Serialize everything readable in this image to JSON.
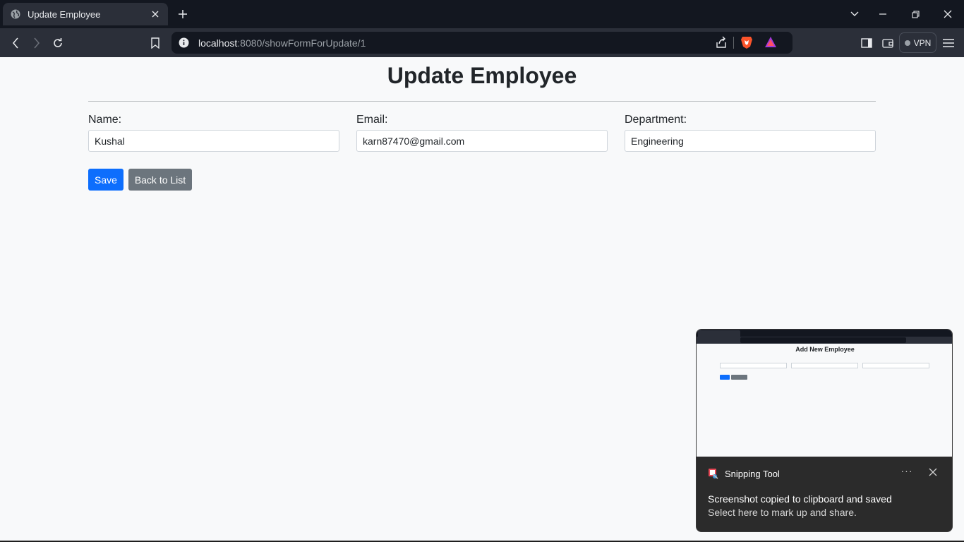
{
  "browser": {
    "tab_title": "Update Employee",
    "url_host": "localhost",
    "url_rest": ":8080/showFormForUpdate/1",
    "vpn_label": "VPN"
  },
  "page": {
    "title": "Update Employee",
    "fields": [
      {
        "label": "Name:",
        "value": "Kushal"
      },
      {
        "label": "Email:",
        "value": "karn87470@gmail.com"
      },
      {
        "label": "Department:",
        "value": "Engineering"
      }
    ],
    "save_label": "Save",
    "back_label": "Back to List"
  },
  "notification": {
    "app_name": "Snipping Tool",
    "more_label": "···",
    "title": "Screenshot copied to clipboard and saved",
    "body": "Select here to mark up and share.",
    "thumbnail_title": "Add New Employee"
  },
  "colors": {
    "primary": "#0d6efd",
    "secondary": "#6c757d",
    "page_bg": "#f8f9fa",
    "chrome_dark": "#131720",
    "chrome_toolbar": "#2b2f39"
  }
}
